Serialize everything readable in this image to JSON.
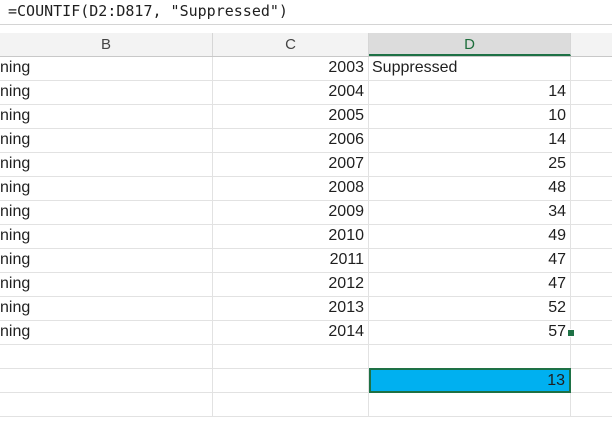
{
  "formula_bar": {
    "formula": "=COUNTIF(D2:D817, \"Suppressed\")"
  },
  "columns": [
    "B",
    "C",
    "D",
    ""
  ],
  "rows": [
    {
      "b": "ning",
      "c": "2003",
      "d": "Suppressed"
    },
    {
      "b": "ning",
      "c": "2004",
      "d": "14"
    },
    {
      "b": "ning",
      "c": "2005",
      "d": "10"
    },
    {
      "b": "ning",
      "c": "2006",
      "d": "14"
    },
    {
      "b": "ning",
      "c": "2007",
      "d": "25"
    },
    {
      "b": "ning",
      "c": "2008",
      "d": "48"
    },
    {
      "b": "ning",
      "c": "2009",
      "d": "34"
    },
    {
      "b": "ning",
      "c": "2010",
      "d": "49"
    },
    {
      "b": "ning",
      "c": "2011",
      "d": "47"
    },
    {
      "b": "ning",
      "c": "2012",
      "d": "47"
    },
    {
      "b": "ning",
      "c": "2013",
      "d": "52"
    },
    {
      "b": "ning",
      "c": "2014",
      "d": "57"
    },
    {
      "b": "",
      "c": "",
      "d": ""
    },
    {
      "b": "",
      "c": "",
      "d": "13"
    },
    {
      "b": "",
      "c": "",
      "d": ""
    }
  ],
  "selected_cell_value": "13",
  "colors": {
    "selection_fill": "#00b0f0",
    "selection_border": "#1e7145",
    "active_header_text": "#1e6e3c"
  }
}
